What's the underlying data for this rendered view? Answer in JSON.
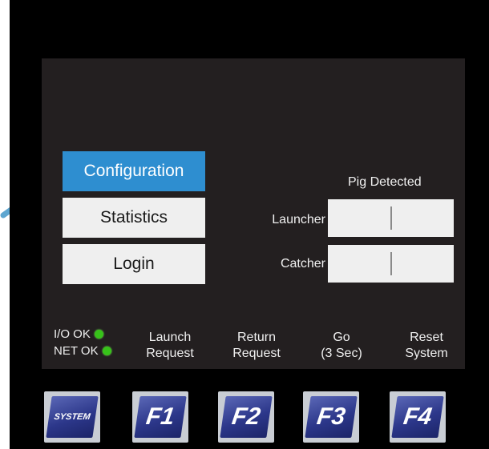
{
  "sidebar": {
    "items": [
      {
        "label": "Configuration",
        "active": true
      },
      {
        "label": "Statistics",
        "active": false
      },
      {
        "label": "Login",
        "active": false
      }
    ]
  },
  "pig_panel": {
    "header": "Pig Detected",
    "rows": [
      {
        "label": "Launcher"
      },
      {
        "label": "Catcher"
      }
    ]
  },
  "status": {
    "io": "I/O OK",
    "net": "NET OK",
    "led_color": "#37c21a"
  },
  "function_labels": [
    {
      "line1": "Launch",
      "line2": "Request"
    },
    {
      "line1": "Return",
      "line2": "Request"
    },
    {
      "line1": "Go",
      "line2": "(3 Sec)"
    },
    {
      "line1": "Reset",
      "line2": "System"
    }
  ],
  "hardware_keys": [
    {
      "label": "SYSTEM"
    },
    {
      "label": "F1"
    },
    {
      "label": "F2"
    },
    {
      "label": "F3"
    },
    {
      "label": "F4"
    }
  ],
  "colors": {
    "accent": "#2e8ed0",
    "screen_bg": "#231f20",
    "bezel": "#000000",
    "arrow": "#5ea6d0"
  },
  "icons": {
    "pointer": "arrow-icon"
  }
}
